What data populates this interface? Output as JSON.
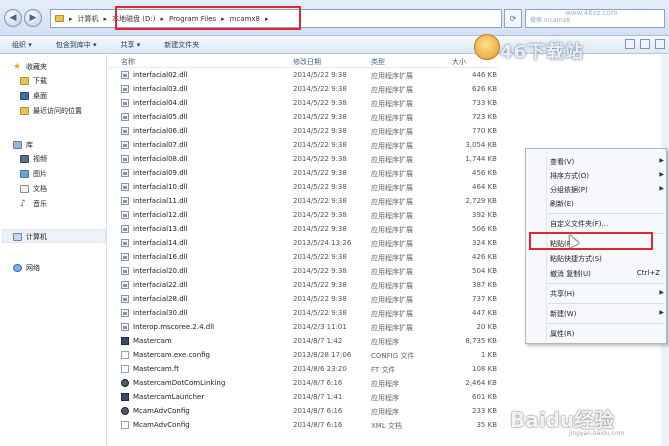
{
  "address": {
    "crumbs": [
      "计算机",
      "本地磁盘 (D:)",
      "Program Files",
      "mcamx8"
    ],
    "search_placeholder": "搜索 mcamx8"
  },
  "watermark": {
    "site_logo": "46下载站",
    "site_url": "www.46xz.com",
    "baidu": "Baidu经验",
    "baidu_url": "jingyan.baidu.com"
  },
  "toolbar": {
    "organize": "组织 ▾",
    "include": "包含到库中 ▾",
    "share": "共享 ▾",
    "new_folder": "新建文件夹"
  },
  "nav": {
    "favorites": "收藏夹",
    "downloads": "下载",
    "desktop": "桌面",
    "recent": "最近访问的位置",
    "libraries": "库",
    "videos": "视频",
    "pictures": "图片",
    "documents": "文档",
    "music": "音乐",
    "computer": "计算机",
    "network": "网络"
  },
  "columns": {
    "name": "名称",
    "date": "修改日期",
    "type": "类型",
    "size": "大小"
  },
  "files": [
    {
      "name": "interfacial02.dll",
      "date": "2014/5/22 9:38",
      "type": "应用程序扩展",
      "size": "446 KB",
      "icon": "dll"
    },
    {
      "name": "interfacial03.dll",
      "date": "2014/5/22 9:38",
      "type": "应用程序扩展",
      "size": "626 KB",
      "icon": "dll"
    },
    {
      "name": "interfacial04.dll",
      "date": "2014/5/22 9:38",
      "type": "应用程序扩展",
      "size": "733 KB",
      "icon": "dll"
    },
    {
      "name": "interfacial05.dll",
      "date": "2014/5/22 9:38",
      "type": "应用程序扩展",
      "size": "723 KB",
      "icon": "dll"
    },
    {
      "name": "interfacial06.dll",
      "date": "2014/5/22 9:38",
      "type": "应用程序扩展",
      "size": "770 KB",
      "icon": "dll"
    },
    {
      "name": "interfacial07.dll",
      "date": "2014/5/22 9:38",
      "type": "应用程序扩展",
      "size": "3,054 KB",
      "icon": "dll"
    },
    {
      "name": "interfacial08.dll",
      "date": "2014/5/22 9:38",
      "type": "应用程序扩展",
      "size": "1,744 KB",
      "icon": "dll"
    },
    {
      "name": "interfacial09.dll",
      "date": "2014/5/22 9:38",
      "type": "应用程序扩展",
      "size": "456 KB",
      "icon": "dll"
    },
    {
      "name": "interfacial10.dll",
      "date": "2014/5/22 9:38",
      "type": "应用程序扩展",
      "size": "464 KB",
      "icon": "dll"
    },
    {
      "name": "interfacial11.dll",
      "date": "2014/5/22 9:38",
      "type": "应用程序扩展",
      "size": "2,729 KB",
      "icon": "dll"
    },
    {
      "name": "interfacial12.dll",
      "date": "2014/5/22 9:38",
      "type": "应用程序扩展",
      "size": "392 KB",
      "icon": "dll"
    },
    {
      "name": "interfacial13.dll",
      "date": "2014/5/22 9:38",
      "type": "应用程序扩展",
      "size": "506 KB",
      "icon": "dll"
    },
    {
      "name": "interfacial14.dll",
      "date": "2013/5/24 13:26",
      "type": "应用程序扩展",
      "size": "324 KB",
      "icon": "dll"
    },
    {
      "name": "interfacial16.dll",
      "date": "2014/5/22 9:38",
      "type": "应用程序扩展",
      "size": "426 KB",
      "icon": "dll"
    },
    {
      "name": "interfacial20.dll",
      "date": "2014/5/22 9:38",
      "type": "应用程序扩展",
      "size": "504 KB",
      "icon": "dll"
    },
    {
      "name": "interfacial22.dll",
      "date": "2014/5/22 9:38",
      "type": "应用程序扩展",
      "size": "387 KB",
      "icon": "dll"
    },
    {
      "name": "interfacial28.dll",
      "date": "2014/5/22 9:38",
      "type": "应用程序扩展",
      "size": "737 KB",
      "icon": "dll"
    },
    {
      "name": "interfacial30.dll",
      "date": "2014/5/22 9:38",
      "type": "应用程序扩展",
      "size": "447 KB",
      "icon": "dll"
    },
    {
      "name": "Interop.mscoree.2.4.dll",
      "date": "2014/2/3 11:01",
      "type": "应用程序扩展",
      "size": "20 KB",
      "icon": "dll"
    },
    {
      "name": "Mastercam",
      "date": "2014/8/7 1:42",
      "type": "应用程序",
      "size": "8,735 KB",
      "icon": "exe"
    },
    {
      "name": "Mastercam.exe.config",
      "date": "2013/8/28 17:06",
      "type": "CONFIG 文件",
      "size": "1 KB",
      "icon": "cfg"
    },
    {
      "name": "Mastercam.ft",
      "date": "2014/8/6 23:20",
      "type": "FT 文件",
      "size": "108 KB",
      "icon": "ft"
    },
    {
      "name": "MastercamDotComLinking",
      "date": "2014/8/7 6:16",
      "type": "应用程序",
      "size": "2,464 KB",
      "icon": "gear"
    },
    {
      "name": "MastercamLauncher",
      "date": "2014/8/7 1:41",
      "type": "应用程序",
      "size": "601 KB",
      "icon": "exe"
    },
    {
      "name": "McamAdvConfig",
      "date": "2014/8/7 6:16",
      "type": "应用程序",
      "size": "233 KB",
      "icon": "gear"
    },
    {
      "name": "McamAdvConfig",
      "date": "2014/8/7 6:16",
      "type": "XML 文档",
      "size": "35 KB",
      "icon": "cfg"
    }
  ],
  "context_menu": {
    "view": "查看(V)",
    "sort": "排序方式(O)",
    "group": "分组依据(P)",
    "refresh": "刷新(E)",
    "customize": "自定义文件夹(F)...",
    "paste": "粘贴(P)",
    "paste_shortcut": "粘贴快捷方式(S)",
    "undo": "撤消 复制(U)",
    "undo_shortcut": "Ctrl+Z",
    "share": "共享(H)",
    "new": "新建(W)",
    "properties": "属性(R)"
  }
}
